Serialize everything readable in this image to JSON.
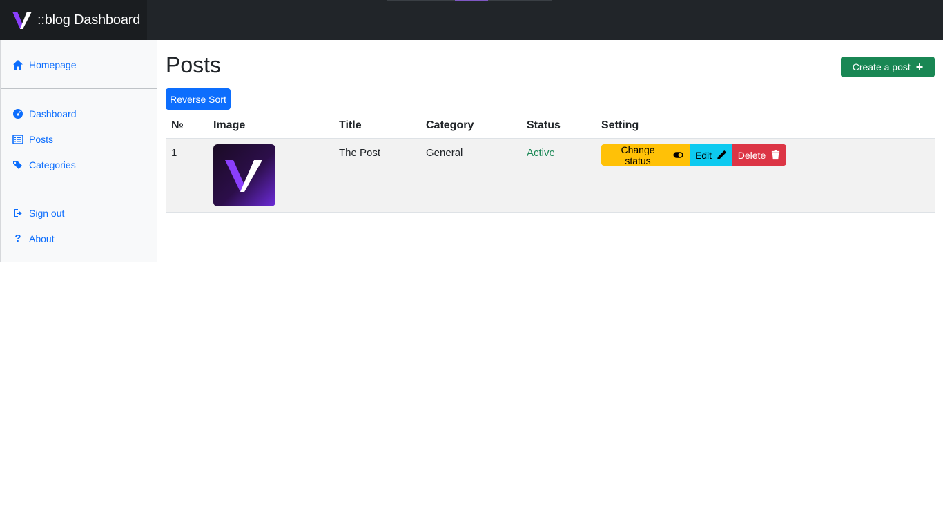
{
  "app": {
    "brand_text": "::blog Dashboard"
  },
  "sidebar": {
    "groups": [
      {
        "items": [
          {
            "label": "Homepage",
            "icon": "home-icon"
          }
        ]
      },
      {
        "items": [
          {
            "label": "Dashboard",
            "icon": "gauge-icon"
          },
          {
            "label": "Posts",
            "icon": "list-icon"
          },
          {
            "label": "Categories",
            "icon": "tags-icon"
          }
        ]
      },
      {
        "items": [
          {
            "label": "Sign out",
            "icon": "sign-out-icon"
          },
          {
            "label": "About",
            "icon": "question-icon"
          }
        ]
      }
    ]
  },
  "main": {
    "title": "Posts",
    "create_button": "Create a post",
    "reverse_button": "Reverse Sort",
    "table": {
      "headers": [
        "№",
        "Image",
        "Title",
        "Category",
        "Status",
        "Setting"
      ],
      "rows": [
        {
          "num": "1",
          "title": "The Post",
          "category": "General",
          "status": "Active"
        }
      ]
    },
    "actions": {
      "change_status": "Change status",
      "edit": "Edit",
      "delete": "Delete"
    }
  },
  "colors": {
    "navbar": "#212529",
    "primary": "#0d6efd",
    "success": "#198754",
    "warning": "#ffc107",
    "info": "#0dcaf0",
    "danger": "#dc3545",
    "brand_purple": "#7e57c2"
  }
}
